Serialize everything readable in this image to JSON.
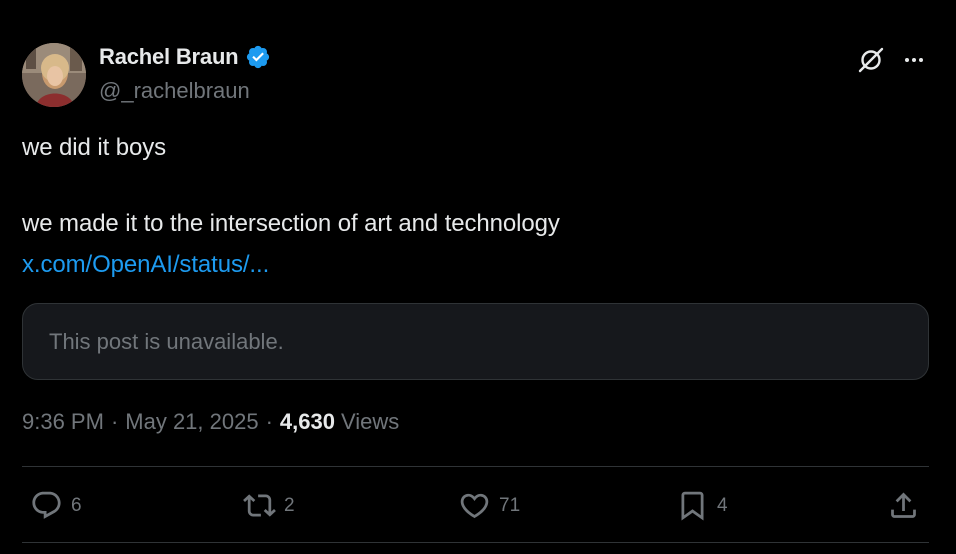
{
  "author": {
    "display_name": "Rachel Braun",
    "handle": "@_rachelbraun",
    "verified": true
  },
  "post": {
    "line1": "we did it boys",
    "line2": "we made it to the intersection of art and technology",
    "link_text": "x.com/OpenAI/status/...",
    "quoted_unavailable": "This post is unavailable."
  },
  "meta": {
    "time": "9:36 PM",
    "separator": "·",
    "date": "May 21, 2025",
    "views_count": "4,630",
    "views_label": "Views"
  },
  "actions": {
    "replies": "6",
    "reposts": "2",
    "likes": "71",
    "bookmarks": "4"
  },
  "colors": {
    "background": "#000000",
    "text_primary": "#e7e9ea",
    "text_secondary": "#71767b",
    "link": "#1d9bf0",
    "verified_badge": "#1d9bf0",
    "divider": "#2f3336"
  },
  "icons": [
    "grok-icon",
    "more-icon",
    "verified-badge-icon",
    "reply-icon",
    "repost-icon",
    "like-icon",
    "bookmark-icon",
    "share-icon"
  ]
}
